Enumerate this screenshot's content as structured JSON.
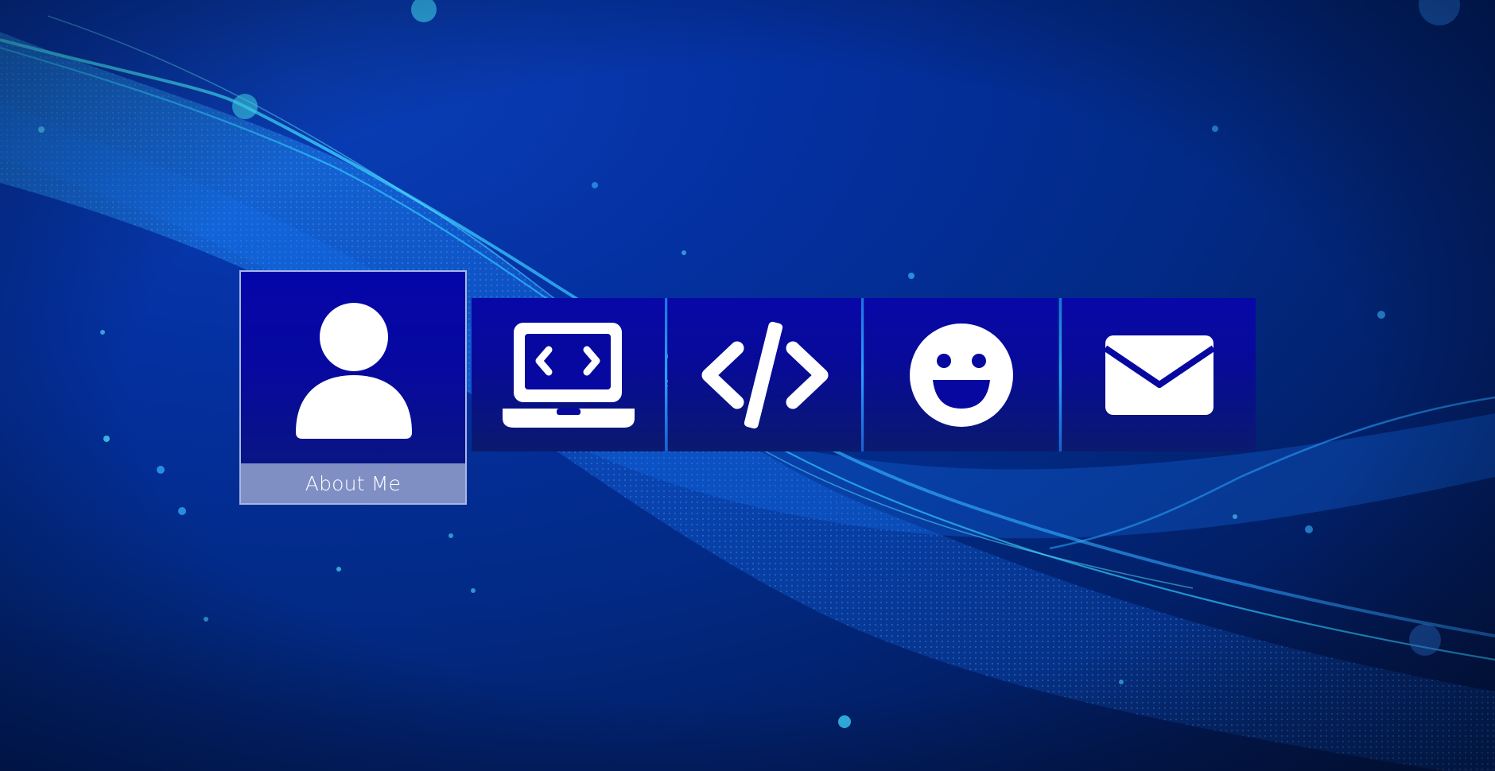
{
  "background": {
    "colors": {
      "deep": "#01143f",
      "mid": "#0430a0",
      "wave": "#1f8fff",
      "glow": "#37d5ff"
    }
  },
  "menu": {
    "items": [
      {
        "label": "About Me",
        "icon": "user-icon",
        "selected": true
      },
      {
        "label": "",
        "icon": "laptop-code-icon",
        "selected": false
      },
      {
        "label": "",
        "icon": "code-icon",
        "selected": false
      },
      {
        "label": "",
        "icon": "smile-icon",
        "selected": false
      },
      {
        "label": "",
        "icon": "envelope-icon",
        "selected": false
      }
    ]
  },
  "colors": {
    "tile": "#0808a8",
    "caption_bg": "#7f8fc4",
    "icon": "#ffffff"
  }
}
